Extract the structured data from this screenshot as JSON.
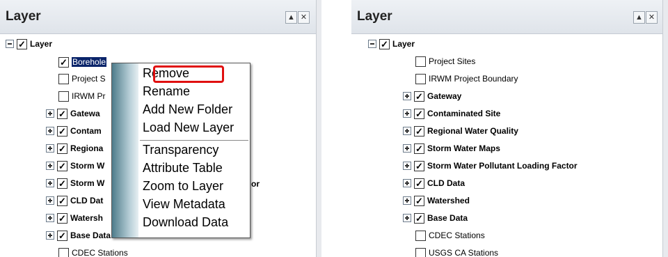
{
  "left_panel": {
    "title": "Layer",
    "tree": [
      {
        "label": "Layer",
        "bold": true,
        "checked": true,
        "expander": "minus"
      },
      {
        "label": "Borehole",
        "bold": false,
        "checked": true,
        "expander": "none",
        "selected": true
      },
      {
        "label": "Project S",
        "bold": false,
        "checked": false,
        "expander": "none"
      },
      {
        "label": "IRWM Pr",
        "bold": false,
        "checked": false,
        "expander": "none"
      },
      {
        "label": "Gatewa",
        "bold": true,
        "checked": true,
        "expander": "plus"
      },
      {
        "label": "Contam",
        "bold": true,
        "checked": true,
        "expander": "plus"
      },
      {
        "label": "Regiona",
        "bold": true,
        "checked": true,
        "expander": "plus"
      },
      {
        "label": "Storm W",
        "bold": true,
        "checked": true,
        "expander": "plus"
      },
      {
        "label": "Storm W",
        "bold": true,
        "checked": true,
        "expander": "plus",
        "trailing": "or"
      },
      {
        "label": "CLD Dat",
        "bold": true,
        "checked": true,
        "expander": "plus"
      },
      {
        "label": "Watersh",
        "bold": true,
        "checked": true,
        "expander": "plus"
      },
      {
        "label": "Base Data",
        "bold": true,
        "checked": true,
        "expander": "plus"
      },
      {
        "label": "CDEC Stations",
        "bold": false,
        "checked": false,
        "expander": "none"
      }
    ],
    "context_menu": {
      "items": [
        "Remove",
        "Rename",
        "Add New Folder",
        "Load New Layer",
        "Transparency",
        "Attribute Table",
        "Zoom to Layer",
        "View Metadata",
        "Download Data"
      ]
    }
  },
  "right_panel": {
    "title": "Layer",
    "tree": [
      {
        "label": "Layer",
        "bold": true,
        "checked": true,
        "expander": "minus"
      },
      {
        "label": "Project Sites",
        "bold": false,
        "checked": false,
        "expander": "none"
      },
      {
        "label": "IRWM Project Boundary",
        "bold": false,
        "checked": false,
        "expander": "none"
      },
      {
        "label": "Gateway",
        "bold": true,
        "checked": true,
        "expander": "plus"
      },
      {
        "label": "Contaminated Site",
        "bold": true,
        "checked": true,
        "expander": "plus"
      },
      {
        "label": "Regional Water Quality",
        "bold": true,
        "checked": true,
        "expander": "plus"
      },
      {
        "label": "Storm Water Maps",
        "bold": true,
        "checked": true,
        "expander": "plus"
      },
      {
        "label": "Storm Water Pollutant Loading Factor",
        "bold": true,
        "checked": true,
        "expander": "plus"
      },
      {
        "label": "CLD Data",
        "bold": true,
        "checked": true,
        "expander": "plus"
      },
      {
        "label": "Watershed",
        "bold": true,
        "checked": true,
        "expander": "plus"
      },
      {
        "label": "Base Data",
        "bold": true,
        "checked": true,
        "expander": "plus"
      },
      {
        "label": "CDEC Stations",
        "bold": false,
        "checked": false,
        "expander": "none"
      },
      {
        "label": "USGS CA Stations",
        "bold": false,
        "checked": false,
        "expander": "none"
      }
    ]
  },
  "buttons": {
    "collapse_glyph": "▲",
    "close_glyph": "✕"
  },
  "colors": {
    "highlight": "#e01010",
    "selection": "#0a246a"
  }
}
